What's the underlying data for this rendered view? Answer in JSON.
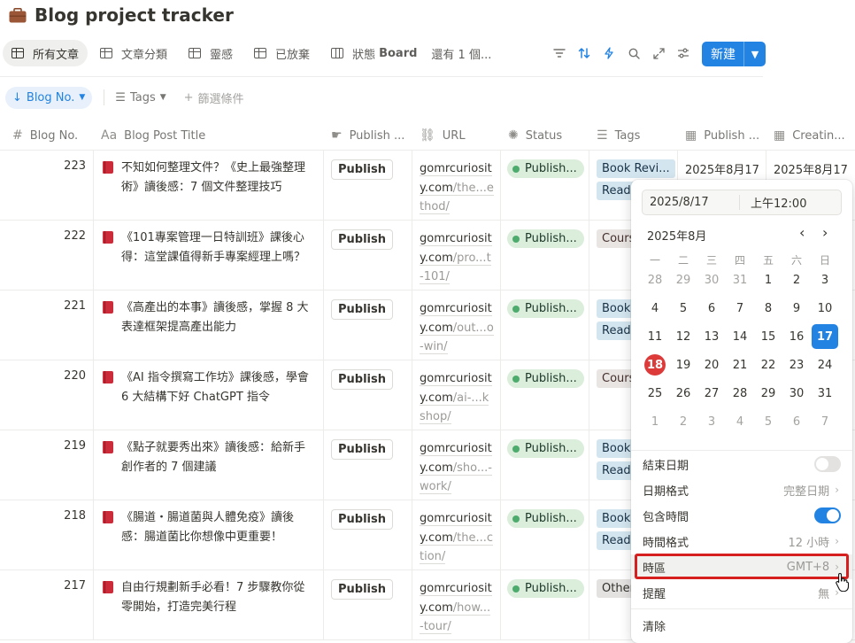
{
  "page": {
    "title": "Blog project tracker"
  },
  "views": {
    "tabs": [
      {
        "label": "所有文章",
        "icon": "table-icon",
        "active": true
      },
      {
        "label": "文章分類",
        "icon": "table-icon"
      },
      {
        "label": "靈感",
        "icon": "table-icon"
      },
      {
        "label": "已放棄",
        "icon": "table-icon"
      },
      {
        "label": "狀態",
        "label_b": "Board",
        "icon": "board-icon"
      }
    ],
    "more": "還有 1 個...",
    "new_label": "新建"
  },
  "filters": {
    "sort_label": "Blog No.",
    "tags_label": "Tags",
    "add_filter": "篩選條件"
  },
  "columns": [
    {
      "label": "Blog No.",
      "icon": "#"
    },
    {
      "label": "Blog Post Title",
      "icon": "Aa"
    },
    {
      "label": "Publish ...",
      "icon": "☛"
    },
    {
      "label": "URL",
      "icon": "⛓"
    },
    {
      "label": "Status",
      "icon": "✺"
    },
    {
      "label": "Tags",
      "icon": "☰"
    },
    {
      "label": "Publish ...",
      "icon": "▦"
    },
    {
      "label": "Creatin...",
      "icon": "▦"
    }
  ],
  "rows": [
    {
      "no": "223",
      "title": "不知如何整理文件？《史上最強整理術》讀後感：7 個文件整理技巧",
      "publish": "Publish",
      "url1": "gomrcuriosity.com",
      "url2": "/the...ethod/",
      "status": "Publish...",
      "tags": [
        "Book Revi...",
        "Readi"
      ],
      "pub_date": "2025年8月17",
      "create_date": "2025年8月17"
    },
    {
      "no": "222",
      "title": "《101專案管理一日特訓班》課後心得：這堂課值得新手專案經理上嗎？",
      "publish": "Publish",
      "url1": "gomrcuriosity.com",
      "url2": "/pro...t-101/",
      "status": "Publish...",
      "tags": [
        "Cours"
      ]
    },
    {
      "no": "221",
      "title": "《高產出的本事》讀後感，掌握 8 大表達框架提高產出能力",
      "publish": "Publish",
      "url1": "gomrcuriosity.com",
      "url2": "/out...o-win/",
      "status": "Publish...",
      "tags": [
        "Book",
        "Readi"
      ]
    },
    {
      "no": "220",
      "title": "《AI 指令撰寫工作坊》課後感，學會 6 大結構下好 ChatGPT 指令",
      "publish": "Publish",
      "url1": "gomrcuriosity.com",
      "url2": "/ai-...kshop/",
      "status": "Publish...",
      "tags": [
        "Cours"
      ]
    },
    {
      "no": "219",
      "title": "《點子就要秀出來》讀後感：給新手創作者的 7 個建議",
      "publish": "Publish",
      "url1": "gomrcuriosity.com",
      "url2": "/sho...-work/",
      "status": "Publish...",
      "tags": [
        "Book",
        "Readi"
      ]
    },
    {
      "no": "218",
      "title": "《腸道・腸道菌與人體免疫》讀後感：腸道菌比你想像中更重要！",
      "publish": "Publish",
      "url1": "gomrcuriosity.com",
      "url2": "/the...ction/",
      "status": "Publish...",
      "tags": [
        "Book",
        "Readi"
      ]
    },
    {
      "no": "217",
      "title": "自由行規劃新手必看！7 步驟教你從零開始，打造完美行程",
      "publish": "Publish",
      "url1": "gomrcuriosity.com",
      "url2": "/how...-tour/",
      "status": "Publish...",
      "tags": [
        "Other"
      ]
    }
  ],
  "datepicker": {
    "date_value": "2025/8/17",
    "time_value": "上午12:00",
    "month_label": "2025年8月",
    "weekdays": [
      "一",
      "二",
      "三",
      "四",
      "五",
      "六",
      "日"
    ],
    "weeks": [
      [
        "28",
        "29",
        "30",
        "31",
        "1",
        "2",
        "3"
      ],
      [
        "4",
        "5",
        "6",
        "7",
        "8",
        "9",
        "10"
      ],
      [
        "11",
        "12",
        "13",
        "14",
        "15",
        "16",
        "17"
      ],
      [
        "18",
        "19",
        "20",
        "21",
        "22",
        "23",
        "24"
      ],
      [
        "25",
        "26",
        "27",
        "28",
        "29",
        "30",
        "31"
      ],
      [
        "1",
        "2",
        "3",
        "4",
        "5",
        "6",
        "7"
      ]
    ],
    "selected_day": "17",
    "today_day": "18",
    "options": {
      "end_date": {
        "label": "結束日期",
        "on": false
      },
      "date_format": {
        "label": "日期格式",
        "value": "完整日期"
      },
      "include_time": {
        "label": "包含時間",
        "on": true
      },
      "time_format": {
        "label": "時間格式",
        "value": "12 小時"
      },
      "timezone": {
        "label": "時區",
        "value": "GMT+8"
      },
      "reminder": {
        "label": "提醒",
        "value": "無"
      },
      "clear": {
        "label": "清除"
      }
    },
    "colors": {
      "accent": "#2383e2",
      "today": "#dd3a3a",
      "highlight_box": "#d61f1f"
    }
  }
}
